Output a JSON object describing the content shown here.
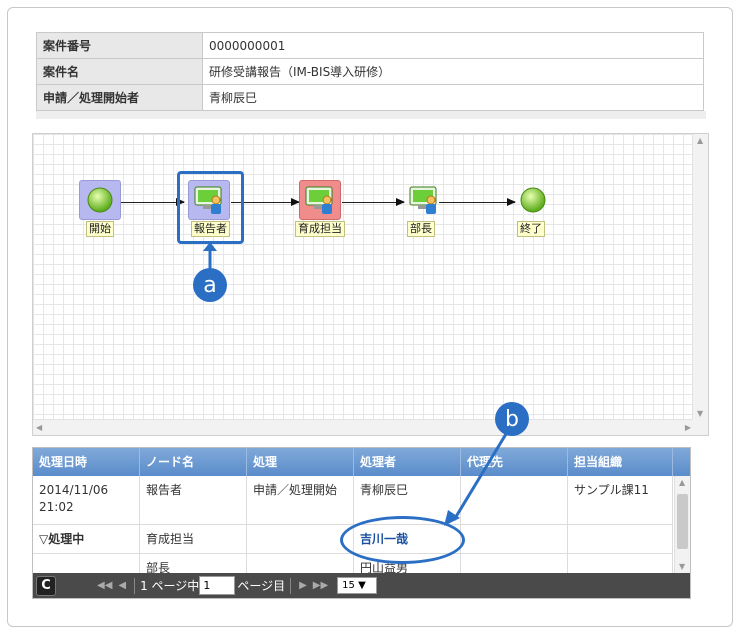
{
  "info": {
    "rows": [
      {
        "label": "案件番号",
        "value": "0000000001"
      },
      {
        "label": "案件名",
        "value": "研修受講報告（IM-BIS導入研修）"
      },
      {
        "label": "申請／処理開始者",
        "value": "青柳辰巳"
      }
    ]
  },
  "flow": {
    "nodes": [
      {
        "label": "開始",
        "icon": "start-node-icon"
      },
      {
        "label": "報告者",
        "icon": "user-task-icon"
      },
      {
        "label": "育成担当",
        "icon": "user-task-icon"
      },
      {
        "label": "部長",
        "icon": "user-task-icon"
      },
      {
        "label": "終了",
        "icon": "end-node-icon"
      }
    ],
    "colors": {
      "start": "#b8b8f0",
      "reporter": "#b8b8f0",
      "trainer": "#f08c8c",
      "grid": "#e6e6e6"
    }
  },
  "callouts": {
    "a": "a",
    "b": "b"
  },
  "history": {
    "columns": [
      "処理日時",
      "ノード名",
      "処理",
      "処理者",
      "代理先",
      "担当組織"
    ],
    "rows": [
      {
        "date": "2014/11/06 21:02",
        "node": "報告者",
        "action": "申請／処理開始",
        "user": "青柳辰巳",
        "proxy": "",
        "org": "サンプル課11"
      },
      {
        "date": "▽処理中",
        "node": "育成担当",
        "action": "",
        "user": "吉川一哉",
        "proxy": "",
        "org": ""
      },
      {
        "date": "",
        "node": "部長",
        "action": "",
        "user": "円山益男",
        "proxy": "",
        "org": ""
      }
    ]
  },
  "pager": {
    "page_prefix": "1 ページ中",
    "page_value": "1",
    "page_suffix": "ページ目",
    "per_page": "15 ▼"
  }
}
